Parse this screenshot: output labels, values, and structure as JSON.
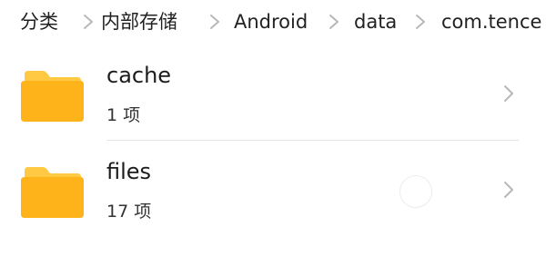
{
  "breadcrumb": {
    "items": [
      {
        "label": "分类"
      },
      {
        "label": "内部存储"
      },
      {
        "label": "Android"
      },
      {
        "label": "data"
      },
      {
        "label": "com.tence"
      }
    ]
  },
  "files": [
    {
      "name": "cache",
      "count": "1 项",
      "icon": "folder-icon"
    },
    {
      "name": "files",
      "count": "17 项",
      "icon": "folder-icon"
    }
  ],
  "colors": {
    "folder_back": "#FFBE2E",
    "folder_front": "#FFB20E",
    "chevron": "#b8b8b8",
    "text": "#1c1c1c"
  }
}
